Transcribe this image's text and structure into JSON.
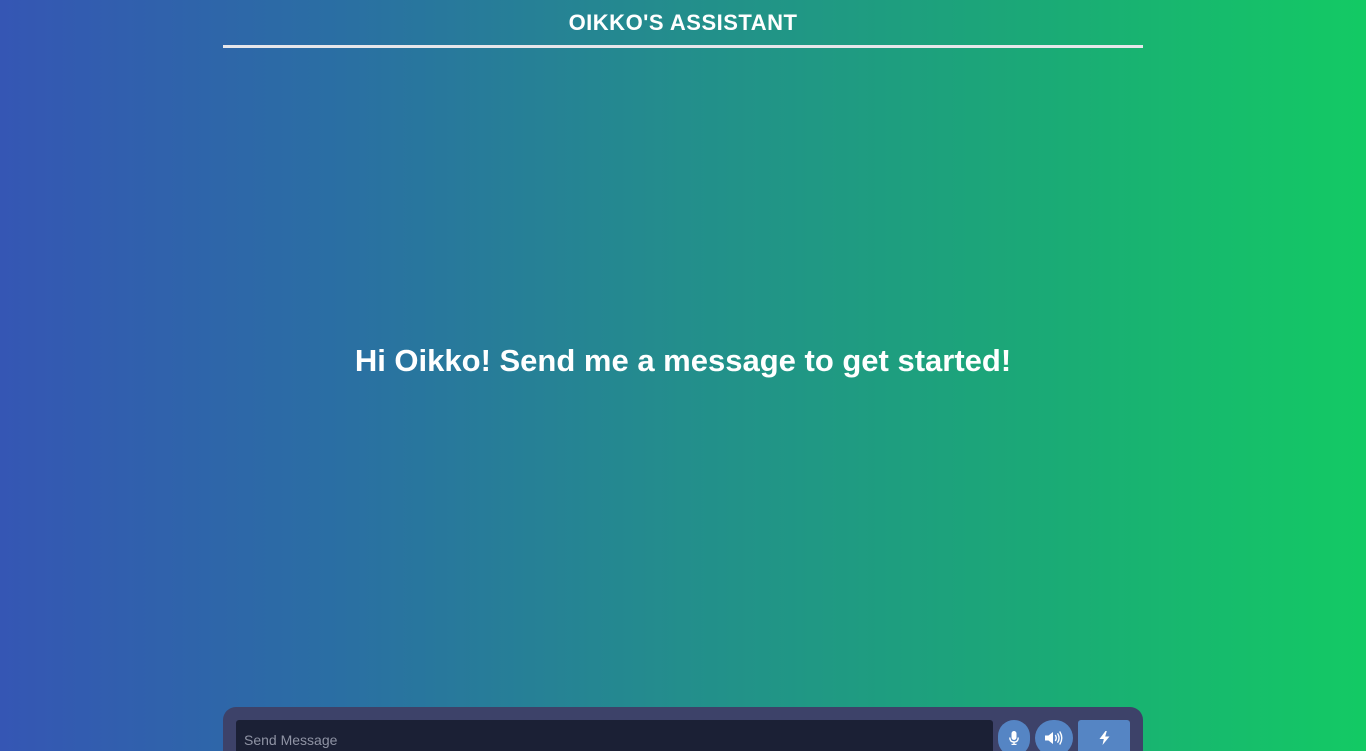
{
  "header": {
    "title": "OIKKO'S ASSISTANT"
  },
  "main": {
    "welcome_message": "Hi Oikko! Send me a message to get started!"
  },
  "composer": {
    "placeholder": "Send Message",
    "value": "",
    "icons": [
      "microphone-icon",
      "speaker-icon",
      "bolt-icon"
    ]
  },
  "colors": {
    "gradient_start": "#3556b4",
    "gradient_end": "#13ca64",
    "composer_bg": "#3d4269",
    "input_bg": "#1b2035",
    "button_bg": "#5585c4"
  }
}
